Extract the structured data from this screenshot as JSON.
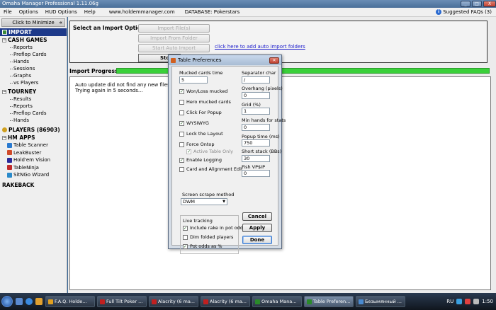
{
  "window": {
    "title": "Omaha Manager Professional 1.11.06g",
    "min": "_",
    "max": "□",
    "close": "X"
  },
  "menu": {
    "items": [
      "File",
      "Options",
      "HUD Options",
      "Help"
    ],
    "url": "www.holdemmanager.com",
    "database": "DATABASE: Pokerstars",
    "faq": "Suggested FAQs (3)"
  },
  "sidebar": {
    "minimize": "Click to Minimize",
    "minimize_x": "«",
    "import": "IMPORT",
    "cash_games": "CASH GAMES",
    "cash_items": [
      "Reports",
      "Preflop Cards",
      "Hands",
      "Sessions",
      "Graphs",
      "vs Players"
    ],
    "tourney": "TOURNEY",
    "tourney_items": [
      "Results",
      "Reports",
      "Preflop Cards",
      "Hands"
    ],
    "players": "PLAYERS (86903)",
    "hm_apps": "HM APPS",
    "apps": [
      {
        "label": "Table Scanner",
        "color": "#2a7ad0"
      },
      {
        "label": "LeakBuster",
        "color": "#d04a2a"
      },
      {
        "label": "Hold'em Vision",
        "color": "#2a2a9a"
      },
      {
        "label": "TableNinja",
        "color": "#c02a2a"
      },
      {
        "label": "SitNGo Wizard",
        "color": "#2a8aca"
      }
    ],
    "rakeback": "RAKEBACK"
  },
  "import": {
    "label": "Select an Import Option:",
    "import_files": "Import File(s)",
    "import_folder": "Import From Folder",
    "start_auto": "Start Auto Import",
    "auto_link": "click here to add auto import folders",
    "stop": "Stop",
    "progress_label": "Import Progress:",
    "progress": 1.0,
    "log": [
      "Auto update did not find any new files...",
      "Trying again in 5 seconds..."
    ]
  },
  "dialog": {
    "title": "Table Preferences",
    "mucked_cards_time": {
      "label": "Mucked cards time",
      "value": "5"
    },
    "separator_char": {
      "label": "Separator char",
      "value": "/"
    },
    "overhang": {
      "label": "Overhang (pixels)",
      "value": "0"
    },
    "grid": {
      "label": "Grid (%)",
      "value": "1"
    },
    "min_hands": {
      "label": "Min hands for stats",
      "value": "0"
    },
    "popup_time": {
      "label": "Popup time (ms)",
      "value": "750"
    },
    "short_stack": {
      "label": "Short stack (BBs)",
      "value": "30"
    },
    "fish_vpip": {
      "label": "Fish VP$IP",
      "value": "0"
    },
    "checkboxes": [
      {
        "label": "Won/Loss mucked",
        "checked": true
      },
      {
        "label": "Hero mucked cards",
        "checked": false
      },
      {
        "label": "Click For Popup",
        "checked": false
      },
      {
        "label": "WYSIWYG",
        "checked": true
      },
      {
        "label": "Lock the Layout",
        "checked": false
      },
      {
        "label": "Force Ontop",
        "checked": false
      },
      {
        "label": "Active Table Only",
        "checked": true
      },
      {
        "label": "Enable Logging",
        "checked": true
      },
      {
        "label": "Card and Alignment Edit",
        "checked": false
      }
    ],
    "screen_scrape": {
      "label": "Screen scrape method",
      "value": "DWM"
    },
    "live_tracking": {
      "label": "Live tracking",
      "items": [
        {
          "label": "Include rake in pot odds",
          "checked": true
        },
        {
          "label": "Dim folded players",
          "checked": false
        },
        {
          "label": "Pot odds as %",
          "checked": true
        }
      ]
    },
    "cancel": "Cancel",
    "apply": "Apply",
    "done": "Done"
  },
  "taskbar": {
    "tasks": [
      {
        "label": "F.A.Q. Holde...",
        "color": "#e0a020"
      },
      {
        "label": "Full Tilt Poker ...",
        "color": "#c02020"
      },
      {
        "label": "Alacrity (6 ma...",
        "color": "#c02020"
      },
      {
        "label": "Alacrity (6 ma...",
        "color": "#c02020"
      },
      {
        "label": "Omaha Mana...",
        "color": "#2a8a2a"
      },
      {
        "label": "Table Preferen...",
        "color": "#2a8a2a"
      },
      {
        "label": "Безымянный ...",
        "color": "#4a8ad0"
      }
    ],
    "lang": "RU",
    "clock": "1:50"
  }
}
